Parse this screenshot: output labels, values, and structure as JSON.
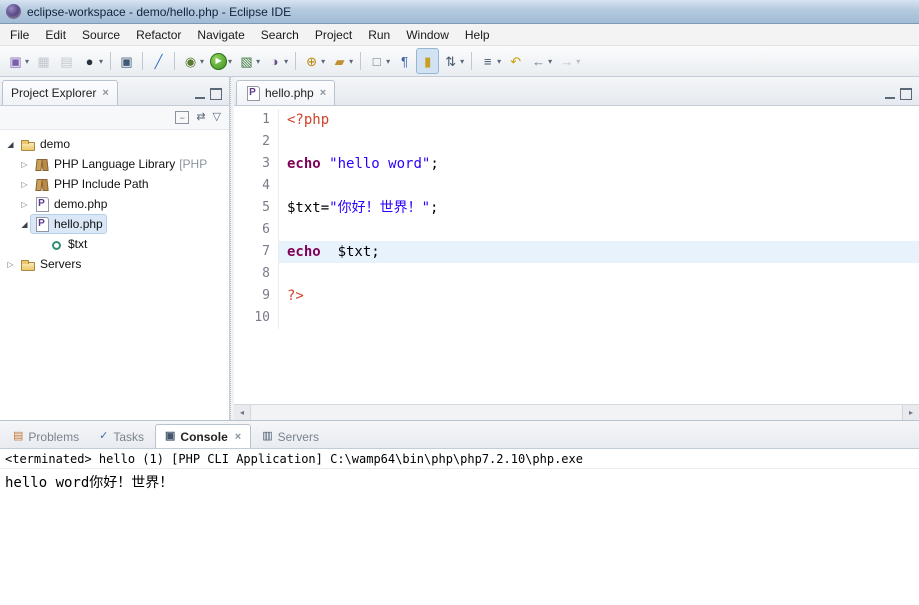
{
  "window": {
    "title": "eclipse-workspace - demo/hello.php - Eclipse IDE"
  },
  "menubar": {
    "items": [
      "File",
      "Edit",
      "Source",
      "Refactor",
      "Navigate",
      "Search",
      "Project",
      "Run",
      "Window",
      "Help"
    ]
  },
  "toolbar": {
    "items": [
      {
        "name": "new-wizard",
        "dropdown": true
      },
      {
        "name": "save",
        "disabled": true
      },
      {
        "name": "print",
        "disabled": true
      },
      {
        "name": "web-browser",
        "dropdown": true
      },
      {
        "sep": true
      },
      {
        "name": "open-console"
      },
      {
        "sep": true
      },
      {
        "name": "cut-annotation"
      },
      {
        "sep": true
      },
      {
        "name": "debug",
        "dropdown": true
      },
      {
        "name": "run",
        "dropdown": true
      },
      {
        "name": "coverage",
        "dropdown": true
      },
      {
        "name": "profile",
        "dropdown": true
      },
      {
        "sep": true
      },
      {
        "name": "external-tools",
        "dropdown": true
      },
      {
        "name": "search-toolbar",
        "dropdown": true
      },
      {
        "sep": true
      },
      {
        "name": "new-web-element",
        "dropdown": true
      },
      {
        "name": "show-whitespace"
      },
      {
        "name": "mark-occurrences",
        "active": true
      },
      {
        "name": "sort",
        "dropdown": true
      },
      {
        "sep": true
      },
      {
        "name": "annotations",
        "dropdown": true
      },
      {
        "name": "last-edit-location"
      },
      {
        "name": "back-history",
        "dropdown": true
      },
      {
        "name": "forward-history",
        "dropdown": true,
        "disabled": true
      }
    ]
  },
  "explorer": {
    "title": "Project Explorer",
    "toolbar": [
      "collapse-all",
      "link-with-editor",
      "view-menu"
    ],
    "tree": [
      {
        "label": "demo",
        "level": 0,
        "arrow": "expanded",
        "icon": "project-folder"
      },
      {
        "label": "PHP Language Library",
        "suffix": "[PHP",
        "level": 1,
        "arrow": "collapsed",
        "icon": "library"
      },
      {
        "label": "PHP Include Path",
        "level": 1,
        "arrow": "collapsed",
        "icon": "library"
      },
      {
        "label": "demo.php",
        "level": 1,
        "arrow": "collapsed",
        "icon": "php-file"
      },
      {
        "label": "hello.php",
        "level": 1,
        "arrow": "expanded",
        "icon": "php-file",
        "selected": true
      },
      {
        "label": "$txt",
        "level": 2,
        "arrow": "none",
        "icon": "variable"
      },
      {
        "label": "Servers",
        "level": 0,
        "arrow": "collapsed",
        "icon": "folder"
      }
    ]
  },
  "editor": {
    "tab": "hello.php",
    "lines": [
      {
        "n": "1",
        "segs": [
          {
            "t": "<?php",
            "c": "phptag"
          }
        ]
      },
      {
        "n": "2",
        "segs": []
      },
      {
        "n": "3",
        "segs": [
          {
            "t": "echo",
            "c": "kw"
          },
          {
            "t": " ",
            "c": ""
          },
          {
            "t": "\"hello word\"",
            "c": "str"
          },
          {
            "t": ";",
            "c": ""
          }
        ]
      },
      {
        "n": "4",
        "segs": []
      },
      {
        "n": "5",
        "segs": [
          {
            "t": "$txt=",
            "c": ""
          },
          {
            "t": "\"你好！世界！\"",
            "c": "str"
          },
          {
            "t": ";",
            "c": ""
          }
        ]
      },
      {
        "n": "6",
        "segs": []
      },
      {
        "n": "7",
        "segs": [
          {
            "t": "echo",
            "c": "kw"
          },
          {
            "t": "  $txt;",
            "c": ""
          }
        ],
        "highlight": true
      },
      {
        "n": "8",
        "segs": []
      },
      {
        "n": "9",
        "segs": [
          {
            "t": "?>",
            "c": "phptag"
          }
        ]
      },
      {
        "n": "10",
        "segs": []
      }
    ]
  },
  "console": {
    "tabs": [
      {
        "label": "Problems",
        "name": "tab-problems"
      },
      {
        "label": "Tasks",
        "name": "tab-tasks"
      },
      {
        "label": "Console",
        "name": "tab-console",
        "active": true,
        "closable": true
      },
      {
        "label": "Servers",
        "name": "tab-servers"
      }
    ],
    "header": "<terminated> hello (1) [PHP CLI Application] C:\\wamp64\\bin\\php\\php7.2.10\\php.exe",
    "output": "hello word你好！世界！"
  }
}
